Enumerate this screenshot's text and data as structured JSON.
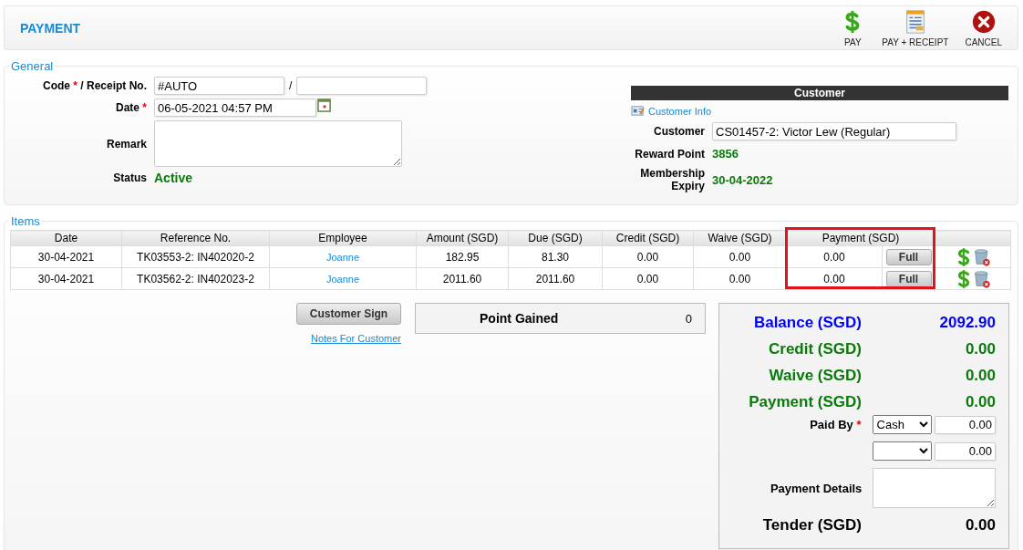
{
  "header": {
    "title": "PAYMENT",
    "actions": [
      {
        "kind": "pay",
        "label": "PAY"
      },
      {
        "kind": "receipt",
        "label": "PAY + RECEIPT"
      },
      {
        "kind": "cancel",
        "label": "CANCEL"
      }
    ]
  },
  "general": {
    "legend": "General",
    "code": {
      "label_code": "Code",
      "required_mark": "*",
      "label_receipt": "/ Receipt No.",
      "value": "#AUTO",
      "separator": "/"
    },
    "date": {
      "label": "Date",
      "required_mark": "*",
      "value": "06-05-2021 04:57 PM"
    },
    "remark": {
      "label": "Remark"
    },
    "status": {
      "label": "Status",
      "value": "Active"
    },
    "customer": {
      "heading": "Customer",
      "info_link": "Customer Info",
      "label": "Customer",
      "value": "CS01457-2: Victor Lew (Regular)",
      "reward_label": "Reward Point",
      "reward_value": "3856",
      "expiry_label": "Membership Expiry",
      "expiry_value": "30-04-2022"
    }
  },
  "items": {
    "legend": "Items",
    "columns": [
      {
        "label": "Date",
        "highlighted": false
      },
      {
        "label": "Reference No.",
        "highlighted": false
      },
      {
        "label": "Employee",
        "highlighted": false
      },
      {
        "label": "Amount (SGD)",
        "highlighted": false
      },
      {
        "label": "Due (SGD)",
        "highlighted": false
      },
      {
        "label": "Credit (SGD)",
        "highlighted": false
      },
      {
        "label": "Waive (SGD)",
        "highlighted": false
      },
      {
        "label": "Payment (SGD)",
        "highlighted": true
      }
    ],
    "rows": [
      {
        "date": "30-04-2021",
        "reference": "TK03553-2: IN402020-2",
        "employee": "Joanne",
        "amount": "182.95",
        "due": "81.30",
        "credit": "0.00",
        "waive": "0.00",
        "payment": "0.00",
        "full_button": "Full"
      },
      {
        "date": "30-04-2021",
        "reference": "TK03562-2: IN402023-2",
        "employee": "Joanne",
        "amount": "2011.60",
        "due": "2011.60",
        "credit": "0.00",
        "waive": "0.00",
        "payment": "0.00",
        "full_button": "Full"
      }
    ]
  },
  "customer_sign_button": "Customer Sign",
  "notes_link": "Notes For Customer",
  "points": {
    "label": "Point Gained",
    "value": "0"
  },
  "summary": {
    "totals": [
      {
        "label": "Balance (SGD)",
        "value": "2092.90",
        "color": "#0000ff"
      },
      {
        "label": "Credit (SGD)",
        "value": "0.00",
        "color": "#0a7a0a"
      },
      {
        "label": "Waive (SGD)",
        "value": "0.00",
        "color": "#0a7a0a"
      },
      {
        "label": "Payment (SGD)",
        "value": "0.00",
        "color": "#0a7a0a"
      }
    ],
    "paid_by_label": "Paid By",
    "paid_by_required": "*",
    "paid_by": [
      {
        "method": "Cash",
        "amount": "0.00"
      },
      {
        "amount": "0.00"
      }
    ],
    "details_label": "Payment Details",
    "tender": {
      "label": "Tender (SGD)",
      "value": "0.00"
    }
  }
}
